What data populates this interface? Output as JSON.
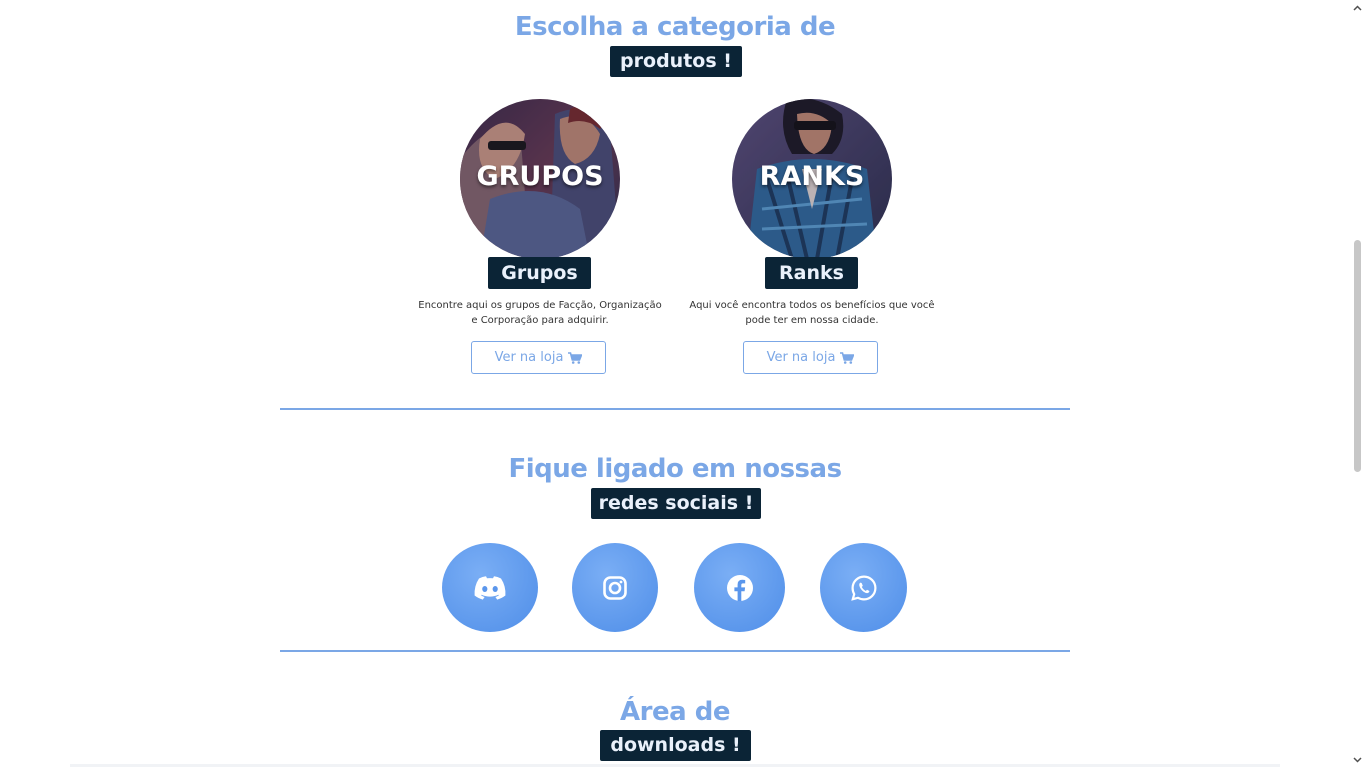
{
  "categories_section": {
    "title": "Escolha a categoria de",
    "tag": "produtos !",
    "items": [
      {
        "image_word": "GRUPOS",
        "label": "Grupos",
        "description_line1": "Encontre aqui os grupos de Facção, Organização",
        "description_line2": "e Corporação para adquirir.",
        "button": "Ver na loja"
      },
      {
        "image_word": "RANKS",
        "label": "Ranks",
        "description_line1": "Aqui você encontra todos os benefícios que você",
        "description_line2": "pode ter em nossa cidade.",
        "button": "Ver na loja"
      }
    ]
  },
  "social_section": {
    "title": "Fique ligado em nossas",
    "tag": "redes sociais !",
    "links": [
      {
        "icon": "discord-icon"
      },
      {
        "icon": "instagram-icon"
      },
      {
        "icon": "facebook-icon"
      },
      {
        "icon": "whatsapp-icon"
      }
    ]
  },
  "downloads_section": {
    "title": "Área de",
    "tag": "downloads !"
  },
  "colors": {
    "accent": "#7ba7e6",
    "tag_bg": "#0b2436",
    "social_bg": "#5a96ec"
  }
}
